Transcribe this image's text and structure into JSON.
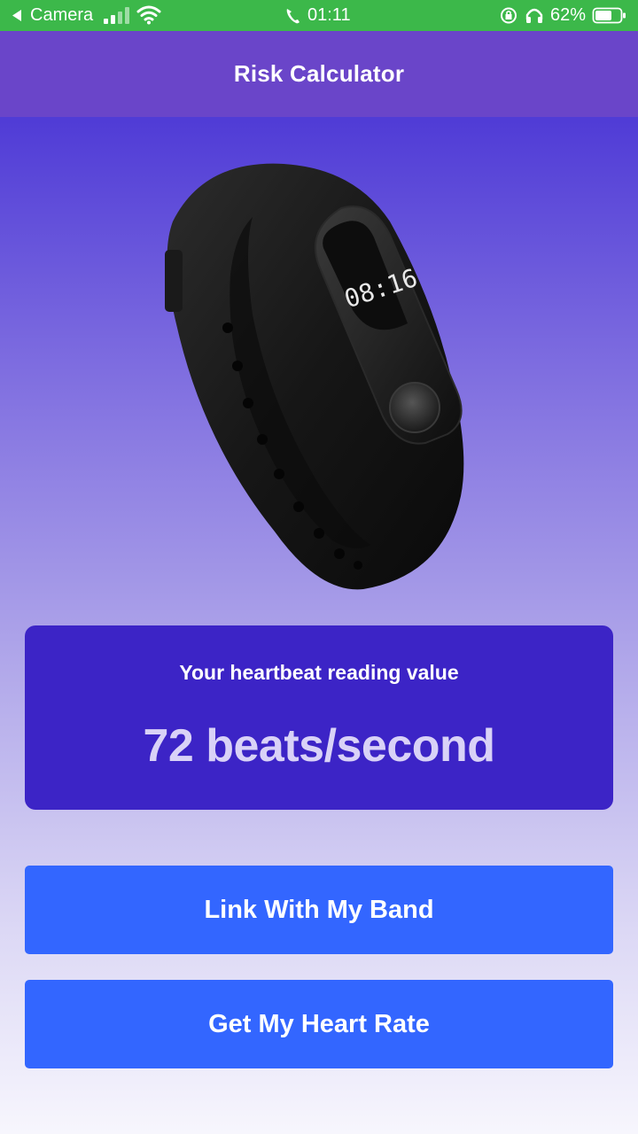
{
  "status_bar": {
    "back_app": "Camera",
    "time": "01:11",
    "battery": "62%"
  },
  "header": {
    "title": "Risk Calculator"
  },
  "band": {
    "display_time": "08:16"
  },
  "reading": {
    "label": "Your heartbeat reading value",
    "value": "72 beats/second"
  },
  "buttons": {
    "link_band": "Link With My Band",
    "get_heart_rate": "Get My Heart Rate"
  },
  "colors": {
    "status_bar": "#3cb84a",
    "header": "#6a45c9",
    "card": "#3c24c6",
    "button": "#3366ff"
  }
}
